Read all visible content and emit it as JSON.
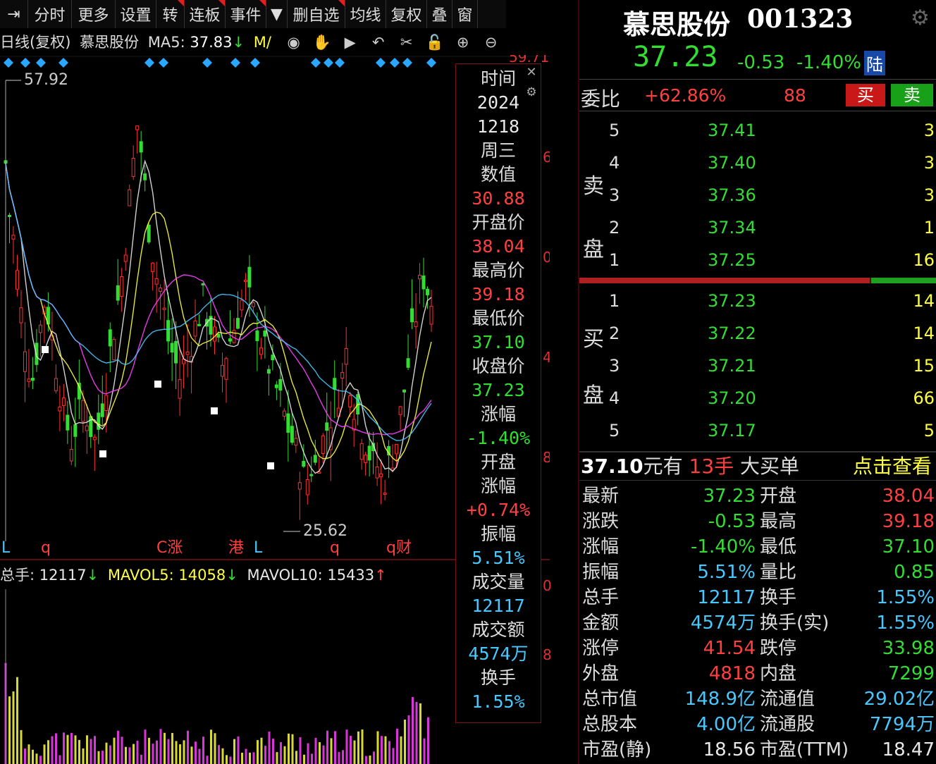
{
  "toolbar": {
    "items": [
      {
        "icon": "exit-icon",
        "label": "⇥"
      },
      {
        "label": "分时"
      },
      {
        "label": "更多"
      },
      {
        "label": "设置"
      },
      {
        "label": "转"
      },
      {
        "label": "连板"
      },
      {
        "label": "事件"
      },
      {
        "label": "▼"
      },
      {
        "label": "删自选"
      },
      {
        "label": "均线"
      },
      {
        "label": "复权"
      },
      {
        "label": "叠"
      },
      {
        "label": "窗"
      }
    ]
  },
  "chart_header": {
    "label": "日线(复权)",
    "stock": "慕思股份",
    "ma5_label": "MA5:",
    "ma5_value": "37.83",
    "ma5_arrow": "↓",
    "more": "M/",
    "icons": [
      "eye-icon",
      "hand-icon",
      "play-icon",
      "undo-icon",
      "scissors-icon",
      "lock-icon",
      "zoom-in-icon",
      "zoom-out-icon"
    ]
  },
  "price_chart": {
    "max_label": "57.92",
    "min_label": "25.62",
    "axis_top": "59.71",
    "axis_labels": [
      "6",
      "0",
      "4",
      "8",
      "0",
      "8"
    ],
    "event_markers": [
      "L",
      "q",
      "C涨",
      "港",
      "L",
      "q",
      "q财"
    ],
    "colors": {
      "up": "#ff3030",
      "down": "#33dd33",
      "ma5": "#e8e8e8",
      "ma10": "#ffff40",
      "ma20": "#ff40ff",
      "ma60": "#33dd33",
      "ma120": "#48c8ff"
    }
  },
  "volume_header": {
    "total_label": "总手:",
    "total_value": "12117",
    "total_arrow": "↓",
    "mavol5_label": "MAVOL5:",
    "mavol5_value": "14058",
    "mavol5_arrow": "↓",
    "mavol10_label": "MAVOL10:",
    "mavol10_value": "15433",
    "mavol10_arrow": "↑"
  },
  "tooltip": {
    "rows": [
      {
        "label": "时间"
      },
      {
        "value": "2024",
        "color": "#e8e8e8"
      },
      {
        "value": "1218",
        "color": "#e8e8e8"
      },
      {
        "label": "周三"
      },
      {
        "label": "数值"
      },
      {
        "value": "30.88",
        "color": "#ff4040"
      },
      {
        "label": "开盘价"
      },
      {
        "value": "38.04",
        "color": "#ff4040"
      },
      {
        "label": "最高价"
      },
      {
        "value": "39.18",
        "color": "#ff4040"
      },
      {
        "label": "最低价"
      },
      {
        "value": "37.10",
        "color": "#33dd33"
      },
      {
        "label": "收盘价"
      },
      {
        "value": "37.23",
        "color": "#33dd33"
      },
      {
        "label": "涨幅"
      },
      {
        "value": "-1.40%",
        "color": "#33dd33"
      },
      {
        "label": "开盘"
      },
      {
        "label": "涨幅"
      },
      {
        "value": "+0.74%",
        "color": "#ff4040"
      },
      {
        "label": "振幅"
      },
      {
        "value": "5.51%",
        "color": "#48c8ff"
      },
      {
        "label": "成交量"
      },
      {
        "value": "12117",
        "color": "#48c8ff"
      },
      {
        "label": "成交额"
      },
      {
        "value": "4574万",
        "color": "#48c8ff"
      },
      {
        "label": "换手"
      },
      {
        "value": "1.55%",
        "color": "#48c8ff"
      }
    ]
  },
  "quote": {
    "name": "慕思股份",
    "code": "001323",
    "price": "37.23",
    "change": "-0.53",
    "change_pct": "-1.40%",
    "tag": "陆"
  },
  "order_ratio": {
    "label": "委比",
    "value": "+62.86%",
    "diff": "88",
    "buy_label": "买",
    "sell_label": "卖"
  },
  "sell_label": [
    "卖",
    "盘"
  ],
  "buy_label": [
    "买",
    "盘"
  ],
  "asks": [
    {
      "level": "5",
      "price": "37.41",
      "vol": "3"
    },
    {
      "level": "4",
      "price": "37.40",
      "vol": "3"
    },
    {
      "level": "3",
      "price": "37.36",
      "vol": "3"
    },
    {
      "level": "2",
      "price": "37.34",
      "vol": "1"
    },
    {
      "level": "1",
      "price": "37.25",
      "vol": "16"
    }
  ],
  "bids": [
    {
      "level": "1",
      "price": "37.23",
      "vol": "14"
    },
    {
      "level": "2",
      "price": "37.22",
      "vol": "14"
    },
    {
      "level": "3",
      "price": "37.21",
      "vol": "15"
    },
    {
      "level": "4",
      "price": "37.20",
      "vol": "66"
    },
    {
      "level": "5",
      "price": "37.17",
      "vol": "5"
    }
  ],
  "big_order": {
    "price": "37.10",
    "text1": "元有",
    "qty": "13手",
    "text2": "大买单",
    "link": "点击查看"
  },
  "stats": [
    {
      "l1": "最新",
      "v1": "37.23",
      "c1": "#33dd33",
      "l2": "开盘",
      "v2": "38.04",
      "c2": "#ff4040"
    },
    {
      "l1": "涨跌",
      "v1": "-0.53",
      "c1": "#33dd33",
      "l2": "最高",
      "v2": "39.18",
      "c2": "#ff4040"
    },
    {
      "l1": "涨幅",
      "v1": "-1.40%",
      "c1": "#33dd33",
      "l2": "最低",
      "v2": "37.10",
      "c2": "#33dd33"
    },
    {
      "l1": "振幅",
      "v1": "5.51%",
      "c1": "#48c8ff",
      "l2": "量比",
      "v2": "0.85",
      "c2": "#33dd33"
    },
    {
      "l1": "总手",
      "v1": "12117",
      "c1": "#48c8ff",
      "l2": "换手",
      "v2": "1.55%",
      "c2": "#48c8ff"
    },
    {
      "l1": "金额",
      "v1": "4574万",
      "c1": "#48c8ff",
      "l2": "换手(实)",
      "v2": "1.55%",
      "c2": "#48c8ff"
    },
    {
      "l1": "涨停",
      "v1": "41.54",
      "c1": "#ff4040",
      "l2": "跌停",
      "v2": "33.98",
      "c2": "#33dd33"
    },
    {
      "l1": "外盘",
      "v1": "4818",
      "c1": "#ff4040",
      "l2": "内盘",
      "v2": "7299",
      "c2": "#33dd33"
    },
    {
      "l1": "总市值",
      "v1": "148.9亿",
      "c1": "#48c8ff",
      "l2": "流通值",
      "v2": "29.02亿",
      "c2": "#48c8ff"
    },
    {
      "l1": "总股本",
      "v1": "4.00亿",
      "c1": "#48c8ff",
      "l2": "流通股",
      "v2": "7794万",
      "c2": "#48c8ff"
    },
    {
      "l1": "市盈(静)",
      "v1": "18.56",
      "c1": "#e8e8e8",
      "l2": "市盈(TTM)",
      "v2": "18.47",
      "c2": "#e8e8e8"
    }
  ],
  "chart_data": {
    "type": "candlestick",
    "series": [
      {
        "name": "MA5",
        "values": [
          37.83
        ]
      }
    ],
    "y_marks": {
      "high": 57.92,
      "low": 25.62,
      "top": 59.71
    },
    "shape": [
      52,
      48,
      46,
      43,
      40,
      38,
      36,
      35,
      37,
      39,
      41,
      40,
      38,
      36,
      34,
      32,
      31,
      30,
      31,
      32,
      33,
      32,
      31,
      30,
      31,
      33,
      35,
      37,
      39,
      41,
      43,
      46,
      49,
      52,
      55,
      53,
      50,
      47,
      45,
      43,
      42,
      40,
      38,
      37,
      36,
      35,
      36,
      37,
      38,
      39,
      40,
      41,
      40,
      39,
      38,
      37,
      36,
      37,
      38,
      39,
      40,
      41,
      42,
      41,
      40,
      39,
      38,
      37,
      36,
      35,
      34,
      33,
      32,
      31,
      30,
      29,
      28,
      27,
      27,
      28,
      28,
      29,
      30,
      31,
      32,
      33,
      34,
      35,
      37,
      35,
      33,
      32,
      31,
      30,
      29,
      28,
      28,
      27,
      27,
      28,
      29,
      30,
      32,
      34,
      36,
      38,
      40,
      42,
      43,
      42,
      41
    ]
  }
}
